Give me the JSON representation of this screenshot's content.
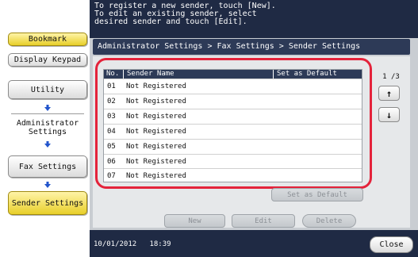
{
  "message": {
    "line1": "To register a new sender, touch [New].",
    "line2": "To edit an existing sender, select",
    "line3": "desired sender and touch [Edit]."
  },
  "sidebar": {
    "bookmark": "Bookmark",
    "display_keypad": "Display Keypad",
    "utility": "Utility",
    "admin_settings_1": "Administrator",
    "admin_settings_2": "Settings",
    "fax_settings": "Fax Settings",
    "sender_settings": "Sender Settings"
  },
  "breadcrumb": "Administrator Settings > Fax Settings > Sender Settings",
  "table": {
    "headers": {
      "no": "No.",
      "name": "Sender Name",
      "default": "Set as Default"
    },
    "rows": [
      {
        "no": "01",
        "name": "Not Registered"
      },
      {
        "no": "02",
        "name": "Not Registered"
      },
      {
        "no": "03",
        "name": "Not Registered"
      },
      {
        "no": "04",
        "name": "Not Registered"
      },
      {
        "no": "05",
        "name": "Not Registered"
      },
      {
        "no": "06",
        "name": "Not Registered"
      },
      {
        "no": "07",
        "name": "Not Registered"
      }
    ]
  },
  "pager": {
    "indicator": "1 /3",
    "up": "↑",
    "down": "↓"
  },
  "buttons": {
    "set_default": "Set as Default",
    "new": "New",
    "edit": "Edit",
    "delete": "Delete"
  },
  "status": {
    "datetime": "10/01/2012   18:39",
    "close": "Close"
  },
  "colors": {
    "highlight": "#e4233b",
    "selected_yellow": "#e8cf2a",
    "header_navy": "#2d3a57",
    "arrow_blue": "#2255cc"
  }
}
